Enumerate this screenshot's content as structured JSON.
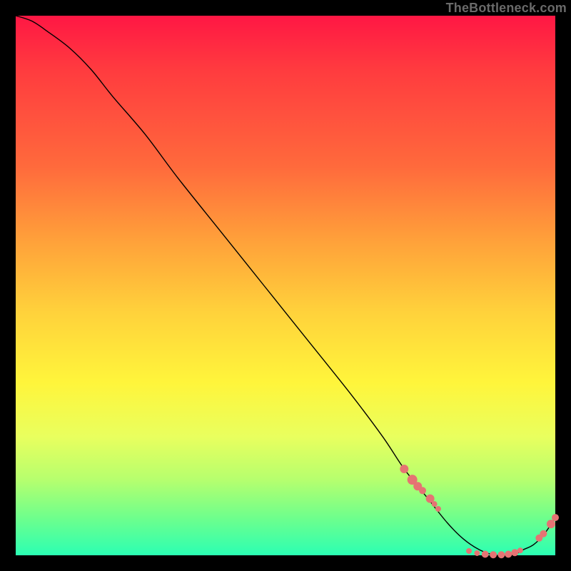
{
  "watermark": "TheBottleneck.com",
  "chart_data": {
    "type": "line",
    "title": "",
    "xlabel": "",
    "ylabel": "",
    "xlim": [
      0,
      100
    ],
    "ylim": [
      0,
      100
    ],
    "grid": false,
    "legend": false,
    "series": [
      {
        "name": "bottleneck-curve",
        "x": [
          0,
          3,
          6,
          10,
          14,
          18,
          24,
          30,
          38,
          46,
          54,
          62,
          68,
          72,
          76,
          80,
          83,
          86,
          89,
          92,
          94,
          96,
          98,
          100
        ],
        "y": [
          100,
          99,
          97,
          94,
          90,
          85,
          78,
          70,
          60,
          50,
          40,
          30,
          22,
          16,
          11,
          6,
          3,
          1,
          0,
          0,
          1,
          2,
          4,
          7
        ]
      }
    ],
    "scatter_points": {
      "name": "markers",
      "color": "#e57373",
      "points": [
        {
          "x": 72.0,
          "y": 16.0,
          "r": 6
        },
        {
          "x": 73.5,
          "y": 14.0,
          "r": 7
        },
        {
          "x": 74.5,
          "y": 12.8,
          "r": 6
        },
        {
          "x": 75.4,
          "y": 12.0,
          "r": 5
        },
        {
          "x": 76.8,
          "y": 10.5,
          "r": 6
        },
        {
          "x": 77.6,
          "y": 9.5,
          "r": 4
        },
        {
          "x": 78.3,
          "y": 8.6,
          "r": 4
        },
        {
          "x": 84.0,
          "y": 0.8,
          "r": 4
        },
        {
          "x": 85.5,
          "y": 0.4,
          "r": 4
        },
        {
          "x": 87.0,
          "y": 0.2,
          "r": 5
        },
        {
          "x": 88.5,
          "y": 0.1,
          "r": 5
        },
        {
          "x": 90.0,
          "y": 0.1,
          "r": 5
        },
        {
          "x": 91.3,
          "y": 0.2,
          "r": 5
        },
        {
          "x": 92.5,
          "y": 0.5,
          "r": 5
        },
        {
          "x": 93.5,
          "y": 0.9,
          "r": 4
        },
        {
          "x": 97.0,
          "y": 3.2,
          "r": 5
        },
        {
          "x": 97.8,
          "y": 4.0,
          "r": 5
        },
        {
          "x": 99.2,
          "y": 5.8,
          "r": 6
        },
        {
          "x": 100.0,
          "y": 7.0,
          "r": 5
        }
      ]
    }
  }
}
